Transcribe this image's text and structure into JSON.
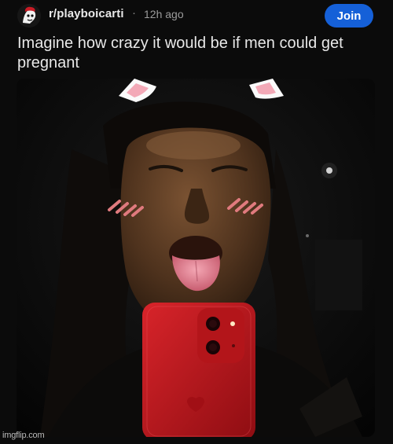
{
  "post": {
    "subreddit": "r/playboicarti",
    "separator": "·",
    "age": "12h ago",
    "join_label": "Join",
    "title": "Imagine how crazy it would be if men could get pregnant",
    "avatar_icon": "subreddit-avatar-icon",
    "image_subject": "selfie-with-cat-ear-filter"
  },
  "colors": {
    "background": "#0b0b0b",
    "join_button": "#1560d8",
    "phone": "#c4161c",
    "text_primary": "#e8e8e8",
    "text_secondary": "#9b9b9b"
  },
  "watermark": "imgflip.com"
}
